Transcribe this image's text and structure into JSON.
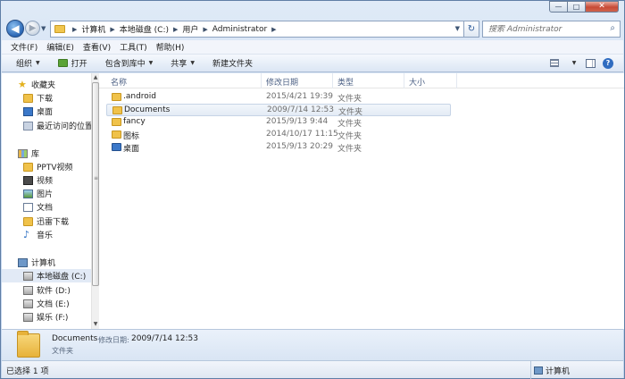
{
  "window": {
    "minimize_glyph": "—",
    "maximize_glyph": "□",
    "close_glyph": "✕"
  },
  "address": {
    "crumbs": [
      "计算机",
      "本地磁盘 (C:)",
      "用户",
      "Administrator"
    ]
  },
  "search": {
    "placeholder": "搜索 Administrator"
  },
  "menu": {
    "items": [
      "文件(F)",
      "编辑(E)",
      "查看(V)",
      "工具(T)",
      "帮助(H)"
    ]
  },
  "toolbar": {
    "organize": "组织",
    "open": "打开",
    "include_in_library": "包含到库中",
    "share": "共享",
    "new_folder": "新建文件夹"
  },
  "nav": {
    "favorites": {
      "label": "收藏夹",
      "items": [
        "下载",
        "桌面",
        "最近访问的位置"
      ]
    },
    "libraries": {
      "label": "库",
      "items": [
        "PPTV视频",
        "视频",
        "图片",
        "文档",
        "迅雷下载",
        "音乐"
      ]
    },
    "computer": {
      "label": "计算机",
      "items": [
        "本地磁盘 (C:)",
        "软件 (D:)",
        "文档 (E:)",
        "娱乐 (F:)"
      ]
    }
  },
  "columns": {
    "name": "名称",
    "modified": "修改日期",
    "type": "类型",
    "size": "大小"
  },
  "files": [
    {
      "name": ".android",
      "modified": "2015/4/21 19:39",
      "type": "文件夹",
      "size": "",
      "icon": "folder-icon"
    },
    {
      "name": "Documents",
      "modified": "2009/7/14 12:53",
      "type": "文件夹",
      "size": "",
      "icon": "folder-icon",
      "selected": true
    },
    {
      "name": "fancy",
      "modified": "2015/9/13 9:44",
      "type": "文件夹",
      "size": "",
      "icon": "folder-icon"
    },
    {
      "name": "图标",
      "modified": "2014/10/17 11:15",
      "type": "文件夹",
      "size": "",
      "icon": "folder-icon"
    },
    {
      "name": "桌面",
      "modified": "2015/9/13 20:29",
      "type": "文件夹",
      "size": "",
      "icon": "desktop-folder-icon"
    }
  ],
  "details": {
    "name": "Documents",
    "modified_label": "修改日期:",
    "modified_value": "2009/7/14 12:53",
    "type": "文件夹"
  },
  "status": {
    "selection": "已选择 1 项",
    "location": "计算机"
  },
  "colors": {
    "selection_bg": "#e3ebf5",
    "folder": "#f0c24a",
    "chrome": "#c9d9ee"
  }
}
